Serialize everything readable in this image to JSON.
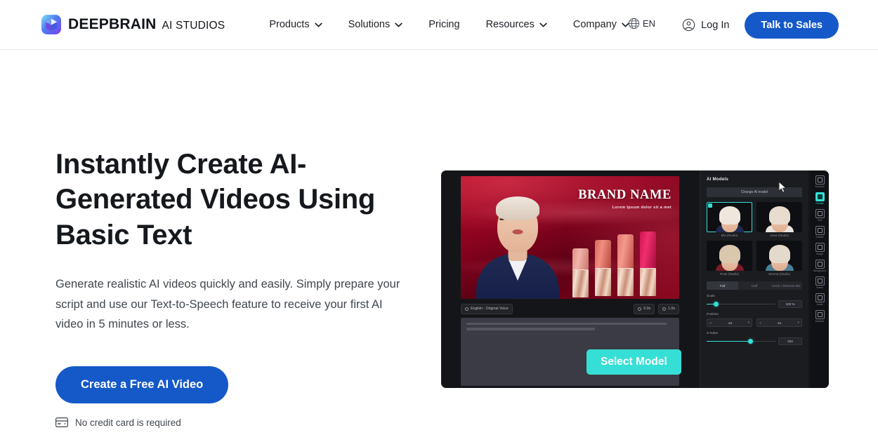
{
  "header": {
    "brand": {
      "name": "DEEPBRAIN",
      "sub": "AI STUDIOS",
      "logo_icon": "cube-logo-icon"
    },
    "nav": [
      {
        "label": "Products",
        "has_caret": true
      },
      {
        "label": "Solutions",
        "has_caret": true
      },
      {
        "label": "Pricing",
        "has_caret": false
      },
      {
        "label": "Resources",
        "has_caret": true
      },
      {
        "label": "Company",
        "has_caret": true
      }
    ],
    "language": {
      "label": "EN",
      "icon": "globe-icon"
    },
    "login": {
      "label": "Log In",
      "icon": "user-circle-icon"
    },
    "cta": {
      "label": "Talk to Sales"
    }
  },
  "hero": {
    "headline": "Instantly Create AI-Generated Videos Using Basic Text",
    "subtext": "Generate realistic AI videos quickly and easily. Simply prepare your script and use our Text-to-Speech feature to receive your first AI video in 5 minutes or less.",
    "cta_label": "Create a Free AI Video",
    "note": "No credit card is required",
    "note_icon": "credit-card-icon"
  },
  "editor": {
    "stage": {
      "brand_title": "BRAND NAME",
      "brand_sub": "Lorem Ipsum dolor sit a met"
    },
    "toolbar": {
      "voice_chip": "English - Original Voice",
      "duration_chip": "0.0s",
      "speed_chip": "1.0x"
    },
    "select_model_button": "Select Model",
    "panel": {
      "title": "AI Models",
      "change_button": "Change AI model",
      "models": [
        {
          "name": "Mia (Studio)",
          "hair": "#efe6dd",
          "shirt": "#1f2a52",
          "selected": true
        },
        {
          "name": "Anna (Studio)",
          "hair": "#e8dcce",
          "shirt": "#e9e4dd",
          "selected": false
        },
        {
          "name": "Rose (Studio)",
          "hair": "#d9c7ae",
          "shirt": "#7b1b26",
          "selected": false
        },
        {
          "name": "Serena (Studio)",
          "hair": "#e4dacb",
          "shirt": "#4a7f95",
          "selected": false
        }
      ],
      "segments": [
        {
          "label": "Full",
          "active": true
        },
        {
          "label": "Half",
          "active": false
        },
        {
          "label": "Circle / Remove BG",
          "active": false
        }
      ],
      "controls": {
        "scale_label": "Scale",
        "scale_value": "100 %",
        "scale_pct": 14,
        "position_label": "Position",
        "position_x_axis": "X",
        "position_x": "-24",
        "position_y_axis": "Y",
        "position_y": "61",
        "zindex_label": "Z-Index",
        "zindex_value": "404",
        "zindex_pct": 64
      }
    },
    "rail": [
      {
        "label": "Scenario",
        "icon": "scenario-icon",
        "active": false
      },
      {
        "label": "Portrait",
        "icon": "portrait-icon",
        "active": true
      },
      {
        "label": "Text",
        "icon": "text-icon",
        "active": false
      },
      {
        "label": "Subtitle",
        "icon": "subtitle-icon",
        "active": false
      },
      {
        "label": "Image",
        "icon": "image-icon",
        "active": false
      },
      {
        "label": "Background",
        "icon": "background-icon",
        "active": false
      },
      {
        "label": "Frame",
        "icon": "frame-icon",
        "active": false
      },
      {
        "label": "Audio",
        "icon": "audio-icon",
        "active": false
      },
      {
        "label": "Element",
        "icon": "element-icon",
        "active": false
      }
    ]
  },
  "colors": {
    "brand_blue": "#1559c9",
    "accent_cyan": "#36dfd5",
    "text_dark": "#15181c"
  }
}
